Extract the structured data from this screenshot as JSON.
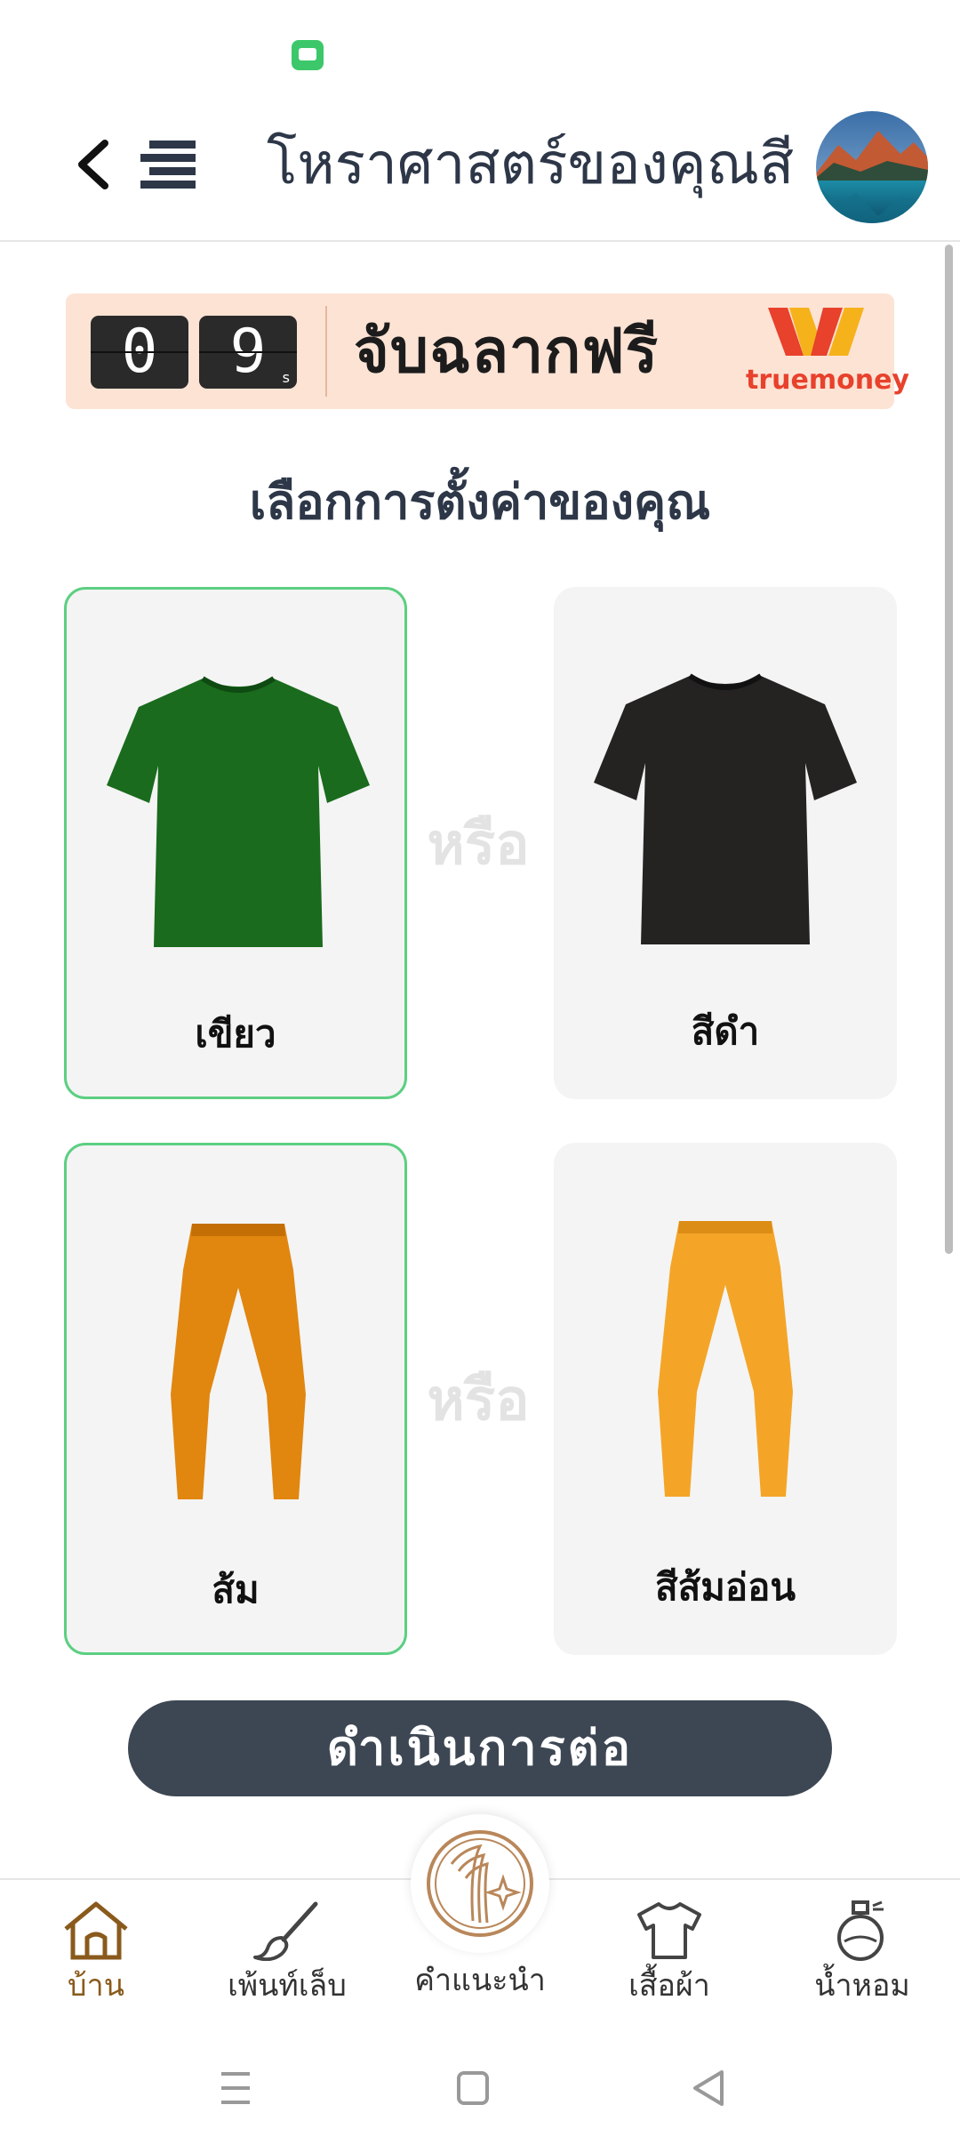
{
  "header": {
    "title": "โหราศาสตร์ของคุณสี"
  },
  "banner": {
    "countdown_digits": [
      "0",
      "9"
    ],
    "countdown_unit": "s",
    "text": "จับฉลากฟรี",
    "brand": "truemoney"
  },
  "section_title": "เลือกการตั้งค่าของคุณ",
  "options": {
    "or_label": "หรือ",
    "shirts": [
      {
        "label": "เขียว",
        "color": "#1a6b1d",
        "selected": true
      },
      {
        "label": "สีดำ",
        "color": "#252322",
        "selected": false
      }
    ],
    "pants": [
      {
        "label": "ส้ม",
        "color": "#e1860f",
        "selected": true
      },
      {
        "label": "สีส้มอ่อน",
        "color": "#f4a528",
        "selected": false
      }
    ]
  },
  "continue_label": "ดำเนินการต่อ",
  "bottom_nav": {
    "items": [
      {
        "label": "บ้าน",
        "icon": "home-icon",
        "active": true
      },
      {
        "label": "เพ้นท์เล็บ",
        "icon": "brush-icon",
        "active": false
      },
      {
        "label": "คำแนะนำ",
        "icon": "recommendation-emblem-icon",
        "active": false
      },
      {
        "label": "เสื้อผ้า",
        "icon": "shirt-icon",
        "active": false
      },
      {
        "label": "น้ำหอม",
        "icon": "perfume-icon",
        "active": false
      }
    ]
  },
  "colors": {
    "accent_dark": "#3d4753",
    "selected_border": "#5ccf82",
    "active_nav": "#8a5a1c"
  }
}
